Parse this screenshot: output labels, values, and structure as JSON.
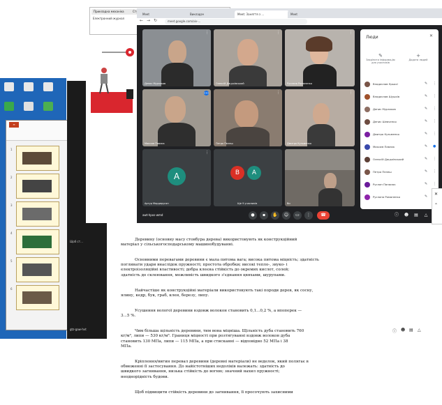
{
  "small_browser": {
    "tabs": [
      "Прикладна механіка",
      "Ступінь посадки ...",
      "..."
    ],
    "address": "Електронний журнал"
  },
  "meet": {
    "tabs": [
      "Meet",
      "Викладач",
      "Meet: Заняття з ...",
      "Meet"
    ],
    "address": "meet.google.com/oiv-...",
    "meeting_code": "awt-hpxs-wmd",
    "tiles": [
      {
        "name": "Денис Мурзаков",
        "kind": "camera"
      },
      {
        "name": "Олексій Дацьківський",
        "kind": "camera"
      },
      {
        "name": "Руслана Романенко",
        "kind": "camera"
      },
      {
        "name": "Максим Павлик",
        "kind": "camera"
      },
      {
        "name": "Петро Пелеш",
        "kind": "camera"
      },
      {
        "name": "Дмитро Кузьменко",
        "kind": "camera"
      },
      {
        "name": "Артур Мордерусян",
        "kind": "avatar",
        "letters": [
          "A"
        ],
        "colors": [
          "#1e8e7e"
        ]
      },
      {
        "name": "Ще 9 учасників",
        "kind": "avatar",
        "letters": [
          "B",
          "A"
        ],
        "colors": [
          "#d93025",
          "#1e8e7e"
        ]
      },
      {
        "name": "Ви",
        "kind": "camera"
      }
    ],
    "controls": [
      "mic-icon",
      "camera-icon",
      "hand-icon",
      "emoji-icon",
      "present-icon",
      "more-icon",
      "hangup-icon"
    ],
    "people_panel": {
      "title": "Люди",
      "actions": [
        "Закріпити інформацію для учасників",
        "Додати людей"
      ],
      "participants": [
        {
          "name": "Владислав Єрьохі",
          "color": "#795548"
        },
        {
          "name": "Владислав Шушків",
          "color": "#a0522d"
        },
        {
          "name": "Денис Мурзаков",
          "color": "#8d6e63"
        },
        {
          "name": "Денис Шевченко",
          "color": "#6d4c41"
        },
        {
          "name": "Дмитро Кузьменко",
          "color": "#7b1fa2"
        },
        {
          "name": "Максим Павлик",
          "color": "#3949ab"
        },
        {
          "name": "Олексій Дацьківський",
          "color": "#5d4037"
        },
        {
          "name": "Петро Пелеш",
          "color": "#795548"
        },
        {
          "name": "Руслан Панасюк",
          "color": "#6a1b9a"
        },
        {
          "name": "Руслана Романенко",
          "color": "#8e24aa"
        }
      ]
    }
  },
  "doc": {
    "paragraphs": [
      "Деревину (основну масу стовбура дерева) використовують як конструкційний\nматеріал у сільськогосподарському машинобудуванні.",
      "Основними перевагами деревини є мала питома вага; висока питома міцність; здатність\nпоглинати удари внаслідок пружності; простота обробки; високі тепло-, звуко- і\nелектроізоляційні властивості; добра клеєна стійкість до окремих кислот, солей;\nздатність до склеювання, можливість швидкого з'єднання цвяхами, шурупами.",
      "Найчастіше як конструкційні матеріали використовують такі породи дерев, як сосну,\nялину, кедр, бук, граб, клен, березу, липу.",
      "Усушення вологої деревини вздовж волокон становить 0,1...0,2 %, а впоперек —\n3...5 %.",
      "Чим більша щільність деревини, тим вона міцніша. Щільність дуба становить 760\nкг/м³, липи — 530 кг/м³. Границя міцності при розтягуванні вздовж волокон дуба\nстановить 130 МПа, липи — 115 МПа, а при стисканні — відповідно 52 МПа і 38\nМПа.",
      "Кріплення/вигин перевал деревини (деревні матеріали) не веделок, який полягає в\nобмеженні її застосування. До найістотніших недоліків належать: здатність до\nшвидкого загнивання, низька стійкість до вогню; значний нахил пружності;\nнеоднорідність будови.",
      "Щоб підвищити стійкість деревини до загнивання, її просочують захисними"
    ]
  },
  "taskbar": {
    "left_caption": "gtz-gaw-hvt",
    "mid_caption": "Щоб ст..."
  }
}
